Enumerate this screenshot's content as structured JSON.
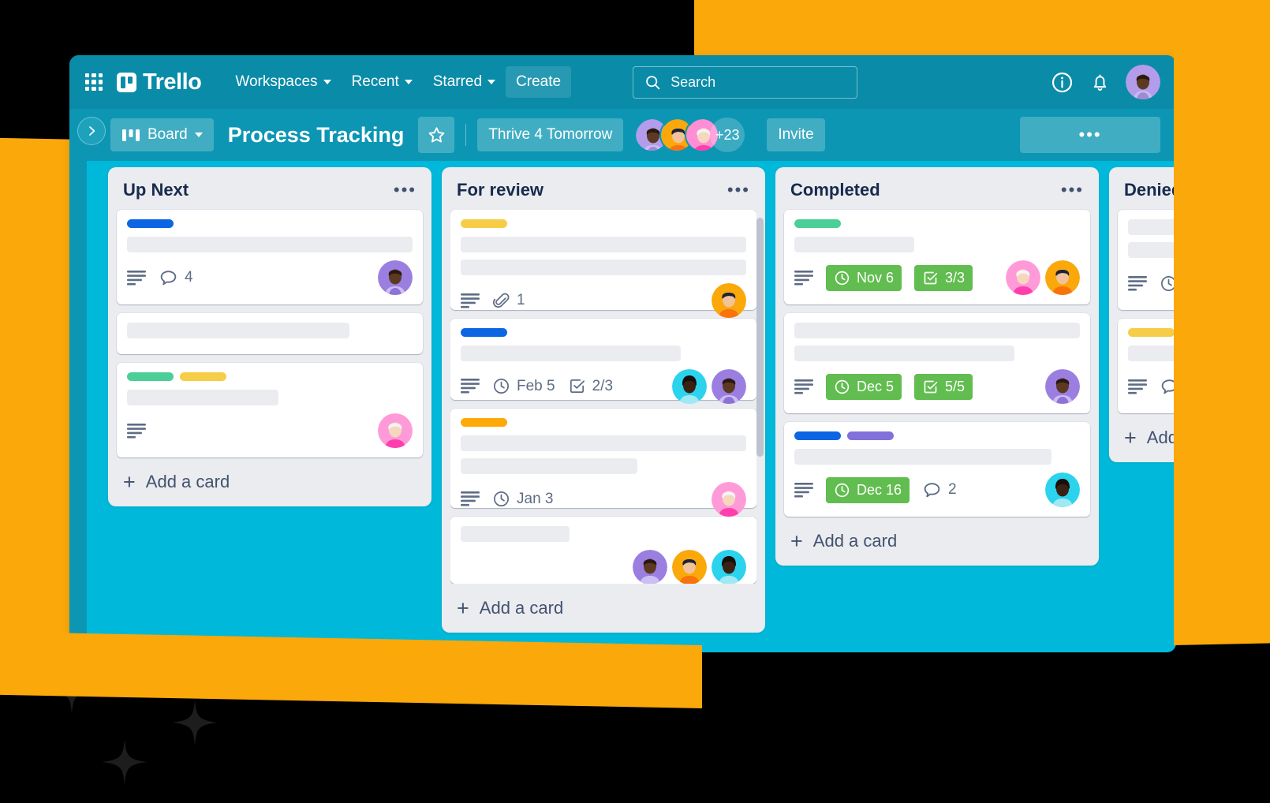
{
  "colors": {
    "brand_teal": "#0A8BA8",
    "board_header_teal": "#0C96B3",
    "board_canvas": "#00B8D9",
    "accent_orange": "#FAA80A",
    "list_bg": "#EBECF0",
    "due_green": "#61BD4F",
    "label_blue": "#0C66E4",
    "label_yellow": "#F5CD47",
    "label_orange": "#FEA362",
    "label_green": "#4BCE97",
    "label_purple": "#8270DB"
  },
  "topnav": {
    "apps_icon": "grid-apps-icon",
    "logo_text": "Trello",
    "items": [
      {
        "label": "Workspaces",
        "has_caret": true
      },
      {
        "label": "Recent",
        "has_caret": true
      },
      {
        "label": "Starred",
        "has_caret": true
      },
      {
        "label": "Create",
        "has_caret": false
      }
    ],
    "search": {
      "placeholder": "Search",
      "icon": "search-icon",
      "value": ""
    },
    "info_icon": "info-circle-icon",
    "notifications_icon": "bell-icon",
    "account_avatar": "avatar-purple-man"
  },
  "boardbar": {
    "view_label": "Board",
    "view_icon": "board-view-icon",
    "title": "Process Tracking",
    "star_icon": "star-outline-icon",
    "workspace_label": "Thrive 4 Tomorrow",
    "members": [
      "avatar-purple-man",
      "avatar-orange-man",
      "avatar-pink-woman"
    ],
    "member_overflow": "+23",
    "invite_label": "Invite",
    "menu_label": "•••",
    "sidebar_toggle_icon": "chevron-right-icon"
  },
  "lists": [
    {
      "title": "Up Next",
      "menu": "•••",
      "add_card_label": "Add a card",
      "cards": [
        {
          "labels": [
            "#0C66E4"
          ],
          "placeholders": [
            100
          ],
          "badges": [
            {
              "type": "description",
              "icon": "description-icon",
              "text": ""
            },
            {
              "type": "comments",
              "icon": "comment-icon",
              "text": "4"
            }
          ],
          "avatars": [
            "avatar-purple-man"
          ]
        },
        {
          "labels": [],
          "placeholders": [
            78
          ],
          "badges": [],
          "avatars": []
        },
        {
          "labels": [
            "#4BCE97",
            "#F5CD47"
          ],
          "placeholders": [
            53
          ],
          "badges": [
            {
              "type": "description",
              "icon": "description-icon",
              "text": ""
            }
          ],
          "avatars": [
            "avatar-pink-woman"
          ]
        }
      ]
    },
    {
      "title": "For review",
      "menu": "•••",
      "add_card_label": "Add a card",
      "has_scrollbar": true,
      "cards": [
        {
          "labels": [
            "#F5CD47"
          ],
          "placeholders": [
            100,
            100
          ],
          "badges": [
            {
              "type": "description",
              "icon": "description-icon",
              "text": ""
            },
            {
              "type": "attachment",
              "icon": "paperclip-icon",
              "text": "1"
            }
          ],
          "avatars": [
            "avatar-orange-man"
          ]
        },
        {
          "labels": [
            "#0C66E4"
          ],
          "placeholders": [
            77
          ],
          "badges": [
            {
              "type": "description",
              "icon": "description-icon",
              "text": ""
            },
            {
              "type": "due",
              "icon": "clock-icon",
              "text": "Feb 5"
            },
            {
              "type": "checklist",
              "icon": "checkbox-icon",
              "text": "2/3"
            }
          ],
          "avatars": [
            "avatar-cyan-woman",
            "avatar-purple-man"
          ]
        },
        {
          "labels": [
            "#FEA362"
          ],
          "placeholders": [
            100,
            62
          ],
          "badges": [
            {
              "type": "description",
              "icon": "description-icon",
              "text": ""
            },
            {
              "type": "due",
              "icon": "clock-icon",
              "text": "Jan 3"
            }
          ],
          "avatars": [
            "avatar-pink-woman"
          ]
        },
        {
          "labels": [],
          "placeholders": [
            38
          ],
          "badges": [],
          "avatars": [
            "avatar-purple-man",
            "avatar-orange-man",
            "avatar-cyan-woman"
          ]
        }
      ]
    },
    {
      "title": "Completed",
      "menu": "•••",
      "add_card_label": "Add a card",
      "cards": [
        {
          "labels": [
            "#4BCE97"
          ],
          "placeholders": [
            42
          ],
          "badges": [
            {
              "type": "description",
              "icon": "description-icon",
              "text": ""
            },
            {
              "type": "due-done",
              "icon": "clock-icon",
              "text": "Nov 6"
            },
            {
              "type": "checklist-done",
              "icon": "checkbox-icon",
              "text": "3/3"
            }
          ],
          "avatars": [
            "avatar-pink-woman",
            "avatar-orange-man"
          ]
        },
        {
          "labels": [],
          "placeholders": [
            100,
            77
          ],
          "badges": [
            {
              "type": "description",
              "icon": "description-icon",
              "text": ""
            },
            {
              "type": "due-done",
              "icon": "clock-icon",
              "text": "Dec 5"
            },
            {
              "type": "checklist-done",
              "icon": "checkbox-icon",
              "text": "5/5"
            }
          ],
          "avatars": [
            "avatar-purple-man"
          ]
        },
        {
          "labels": [
            "#0C66E4",
            "#8270DB"
          ],
          "placeholders": [
            90
          ],
          "badges": [
            {
              "type": "description",
              "icon": "description-icon",
              "text": ""
            },
            {
              "type": "due-done",
              "icon": "clock-icon",
              "text": "Dec 16"
            },
            {
              "type": "comments",
              "icon": "comment-icon",
              "text": "2"
            }
          ],
          "avatars": [
            "avatar-cyan-woman"
          ]
        }
      ]
    },
    {
      "title": "Denied",
      "menu": "",
      "add_card_label": "Add a card",
      "cards": [
        {
          "labels": [],
          "placeholders": [
            70,
            70
          ],
          "badges": [
            {
              "type": "description",
              "icon": "description-icon",
              "text": ""
            },
            {
              "type": "due",
              "icon": "clock-icon",
              "text": ""
            }
          ],
          "avatars": []
        },
        {
          "labels": [
            "#F5CD47"
          ],
          "placeholders": [
            70
          ],
          "badges": [
            {
              "type": "description",
              "icon": "description-icon",
              "text": ""
            },
            {
              "type": "comments",
              "icon": "comment-icon",
              "text": ""
            }
          ],
          "avatars": []
        }
      ]
    }
  ]
}
